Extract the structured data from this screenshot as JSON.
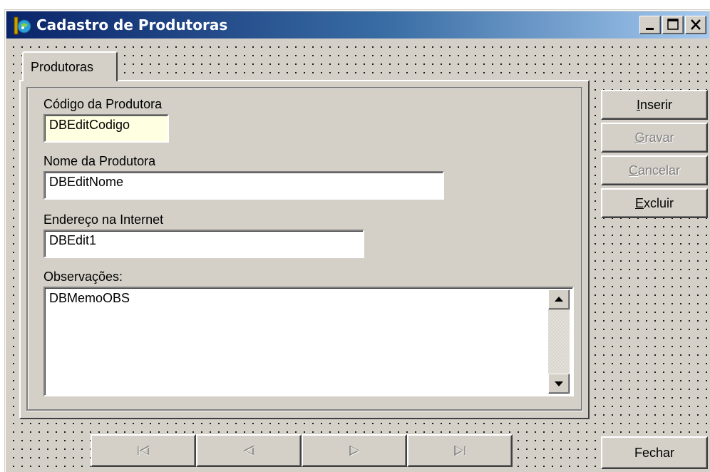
{
  "window": {
    "title": "Cadastro de Produtoras",
    "icons": [
      "app-icon",
      "minimize-icon",
      "maximize-icon",
      "close-icon"
    ]
  },
  "tabs": [
    {
      "label": "Produtoras",
      "selected": true
    }
  ],
  "form": {
    "codigo": {
      "label": "Código da Produtora",
      "value": "DBEditCodigo"
    },
    "nome": {
      "label": "Nome da Produtora",
      "value": "DBEditNome"
    },
    "endereco": {
      "label": "Endereço na Internet",
      "value": "DBEdit1"
    },
    "observacoes": {
      "label": "Observações:",
      "value": "DBMemoOBS"
    }
  },
  "buttons": {
    "inserir": {
      "accel": "I",
      "rest": "nserir",
      "enabled": true
    },
    "gravar": {
      "accel": "G",
      "rest": "ravar",
      "enabled": false
    },
    "cancelar": {
      "accel": "C",
      "rest": "ancelar",
      "enabled": false
    },
    "excluir": {
      "accel": "E",
      "rest": "xcluir",
      "enabled": true
    },
    "fechar": {
      "label": "Fechar",
      "enabled": true
    }
  },
  "navigator": {
    "buttons": [
      "first-record-icon",
      "prior-record-icon",
      "next-record-icon",
      "last-record-icon"
    ],
    "enabled": false
  },
  "colors": {
    "face": "#d4d0c8",
    "title_start": "#0a246a",
    "title_end": "#a6caf0",
    "edit_highlight": "#ffffe1",
    "disabled_text": "#808080"
  }
}
